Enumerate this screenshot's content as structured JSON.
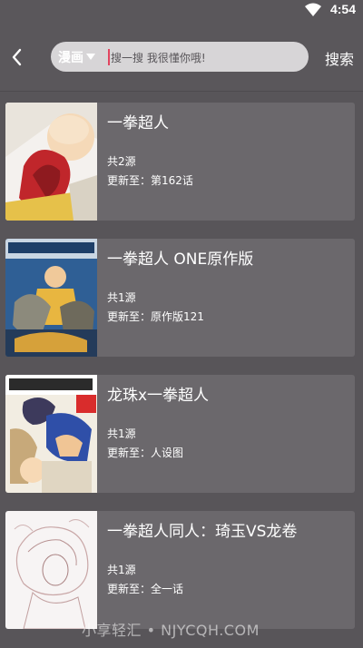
{
  "status_bar": {
    "time": "4:54",
    "wifi_icon": "wifi-icon"
  },
  "header": {
    "back_icon": "chevron-left-icon",
    "category": "漫画",
    "search_placeholder": "搜一搜 我很懂你哦!",
    "search_button": "搜索"
  },
  "results": [
    {
      "title": "一拳超人",
      "sources": "共2源",
      "latest": "更新至：第162话",
      "cover_color": "#b02a2a"
    },
    {
      "title": "一拳超人 ONE原作版",
      "sources": "共1源",
      "latest": "更新至：原作版121",
      "cover_color": "#3a6ea8"
    },
    {
      "title": "龙珠x一拳超人",
      "sources": "共1源",
      "latest": "更新至：人设图",
      "cover_color": "#d8c7a0"
    },
    {
      "title": "一拳超人同人：琦玉VS龙卷",
      "sources": "共1源",
      "latest": "更新至：全一话",
      "cover_color": "#f2ecec"
    }
  ],
  "watermark": "小享轻汇 • NJYCQH.COM",
  "colors": {
    "background": "#585559",
    "card": "#6b686c",
    "search_box": "#d7d5d7",
    "cursor": "#e2445f"
  }
}
